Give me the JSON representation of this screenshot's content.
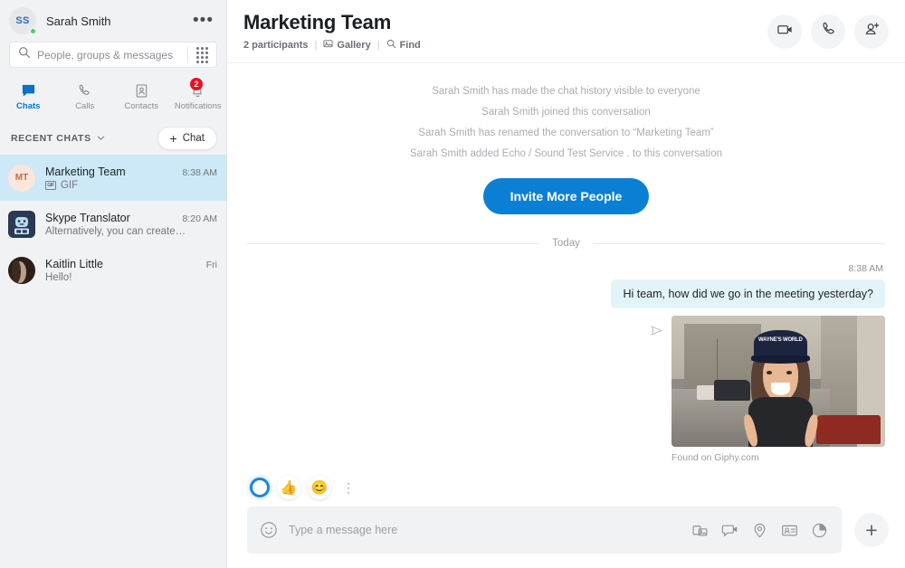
{
  "sidebar": {
    "profile": {
      "initials": "SS",
      "name": "Sarah Smith",
      "presence": "online",
      "more_label": "•••"
    },
    "search": {
      "placeholder": "People, groups & messages",
      "value": "",
      "icon": "search-icon",
      "dialpad_icon": "dialpad-icon"
    },
    "nav_tabs": [
      {
        "label": "Chats",
        "icon": "chat-icon",
        "active": true,
        "badge": ""
      },
      {
        "label": "Calls",
        "icon": "phone-icon",
        "active": false,
        "badge": ""
      },
      {
        "label": "Contacts",
        "icon": "contacts-icon",
        "active": false,
        "badge": ""
      },
      {
        "label": "Notifications",
        "icon": "bell-icon",
        "active": false,
        "badge": "2"
      }
    ],
    "recent": {
      "title": "RECENT CHATS",
      "chevron_icon": "chevron-down-icon",
      "new_chat_label": "Chat",
      "new_chat_plus": "+"
    },
    "chats": [
      {
        "avatar_text": "MT",
        "avatar_kind": "mt",
        "name": "Marketing Team",
        "time": "8:38 AM",
        "preview": "GIF",
        "has_gif_badge": true,
        "selected": true
      },
      {
        "avatar_text": "",
        "avatar_kind": "bot",
        "name": "Skype Translator",
        "time": "8:20 AM",
        "preview": "Alternatively, you can create…",
        "has_gif_badge": false,
        "selected": false
      },
      {
        "avatar_text": "",
        "avatar_kind": "photo",
        "name": "Kaitlin Little",
        "time": "Fri",
        "preview": "Hello!",
        "has_gif_badge": false,
        "selected": false
      }
    ]
  },
  "header": {
    "title": "Marketing Team",
    "participants": "2 participants",
    "separator": "|",
    "gallery_label": "Gallery",
    "find_label": "Find",
    "gallery_icon": "gallery-icon",
    "find_icon": "search-icon",
    "actions": [
      {
        "name": "video-call-button",
        "icon": "video-camera-icon"
      },
      {
        "name": "audio-call-button",
        "icon": "phone-icon"
      },
      {
        "name": "add-people-button",
        "icon": "person-add-icon"
      }
    ]
  },
  "conversation": {
    "system_messages": [
      "Sarah Smith has made the chat history visible to everyone",
      "Sarah Smith joined this conversation",
      "Sarah Smith has renamed the conversation to “Marketing Team”",
      "Sarah Smith added Echo / Sound Test Service . to this conversation"
    ],
    "invite_button_label": "Invite More People",
    "day_divider_label": "Today",
    "message": {
      "time": "8:38 AM",
      "text": "Hi team, how did we go in the meeting yesterday?",
      "status_icon": "sent-tick-icon"
    },
    "gif": {
      "caption": "Found on Giphy.com",
      "cap_text": "WAYNE'S WORLD",
      "status_icon": "sent-tick-icon"
    }
  },
  "reactions": {
    "loading_icon": "loading-ring-icon",
    "items": [
      {
        "name": "reaction-thumbs-up",
        "glyph": "👍"
      },
      {
        "name": "reaction-smile",
        "glyph": "😊"
      }
    ],
    "more_label": "⋮"
  },
  "compose": {
    "emoji_icon": "emoji-smiley-icon",
    "placeholder": "Type a message here",
    "value": "",
    "icons": [
      {
        "name": "send-photo-icon"
      },
      {
        "name": "video-message-icon"
      },
      {
        "name": "location-icon"
      },
      {
        "name": "contact-card-icon"
      },
      {
        "name": "poll-icon"
      }
    ],
    "plus_label": "+"
  },
  "colors": {
    "accent": "#0078d4",
    "invite_button": "#0b7fd4",
    "selected_chat": "#cde9f7",
    "bubble": "#e3f4f8",
    "badge": "#e81123",
    "presence_online": "#44d362"
  }
}
